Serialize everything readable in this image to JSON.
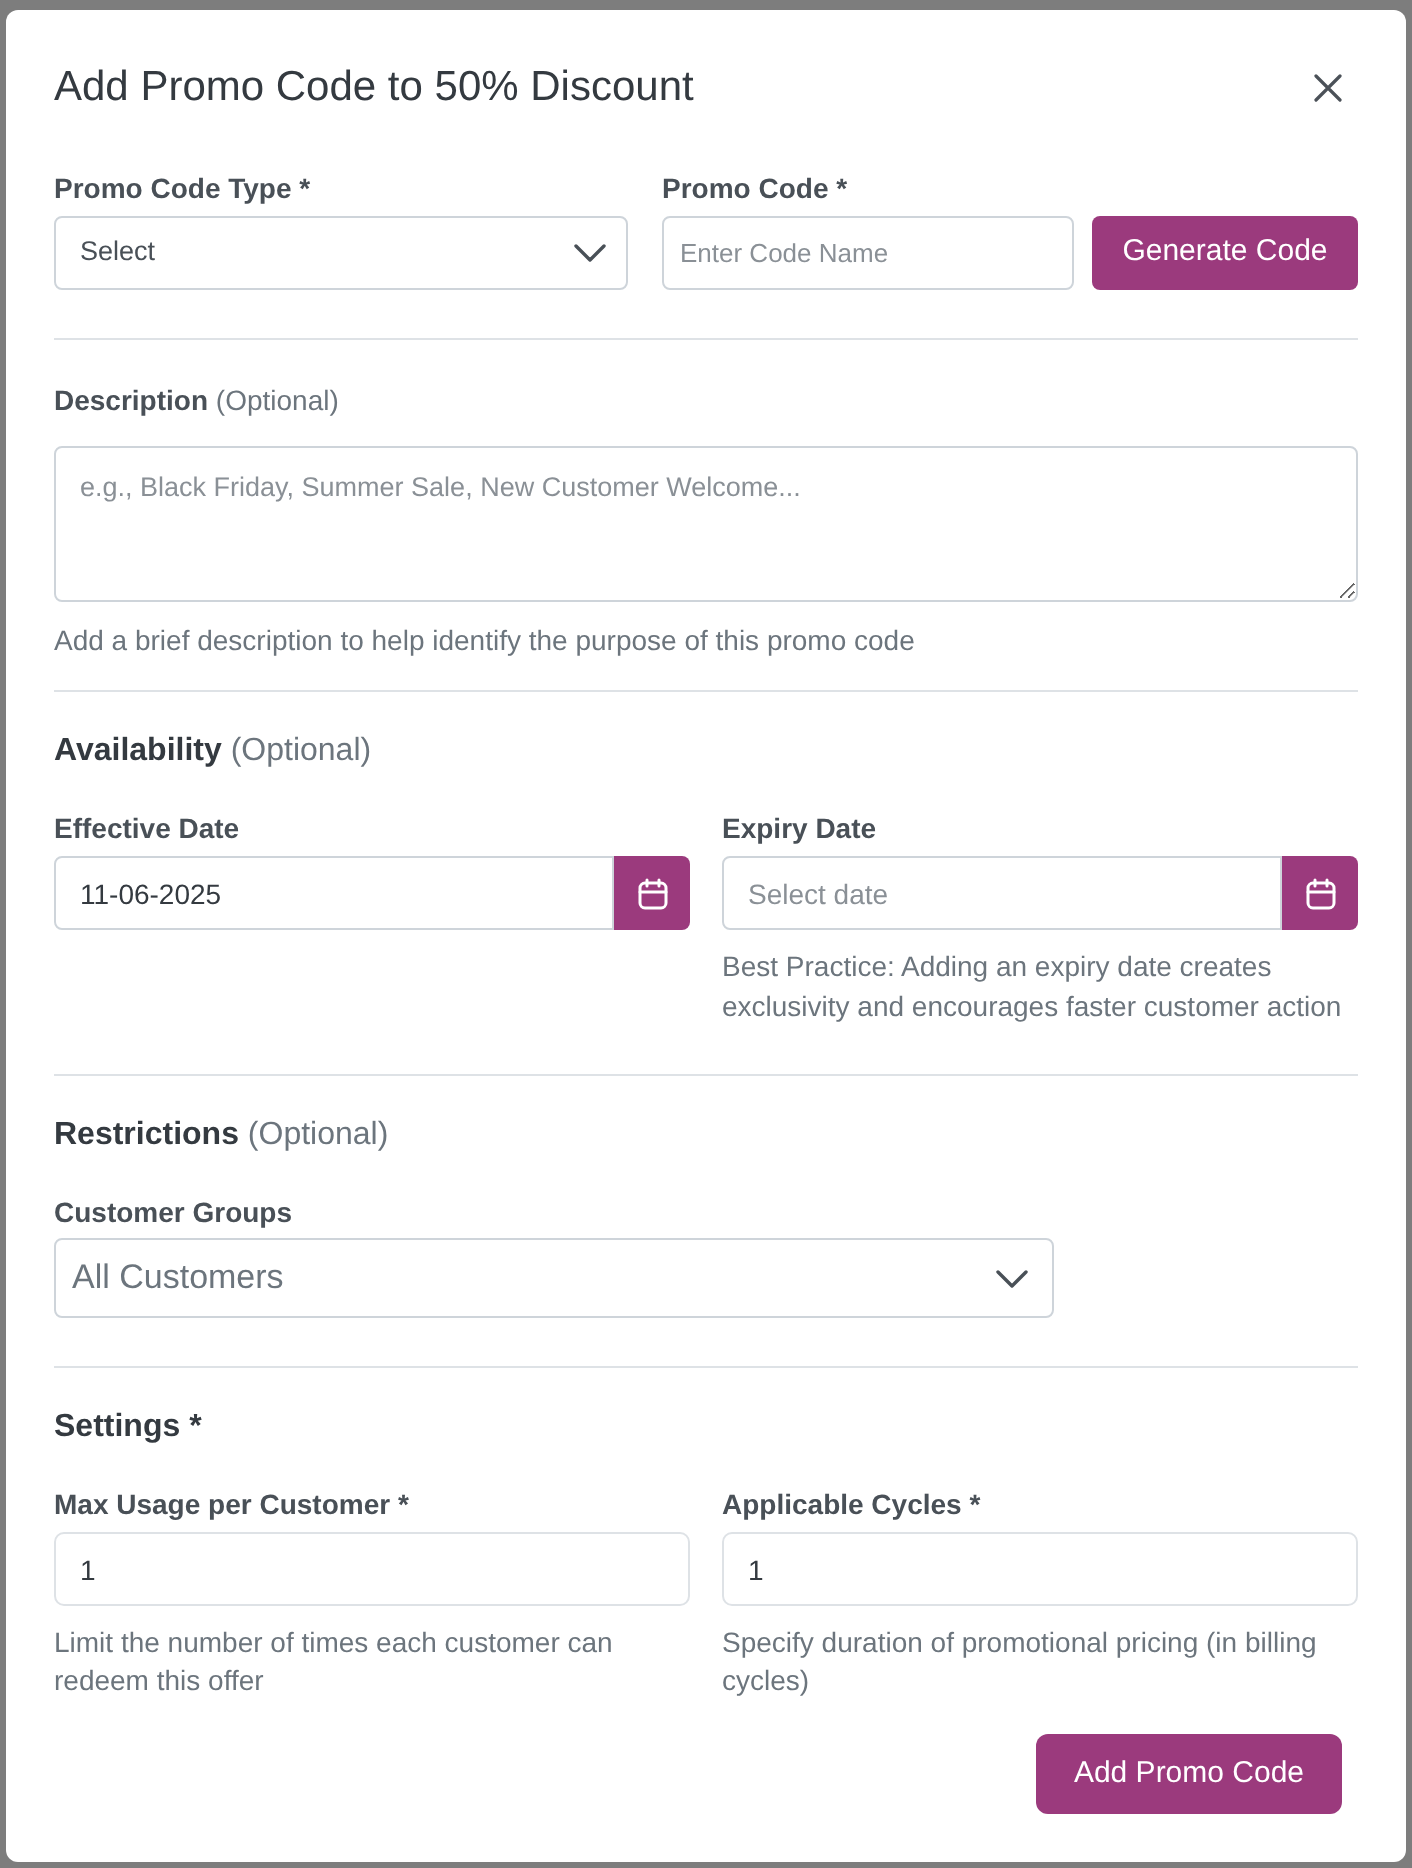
{
  "dialog": {
    "title": "Add Promo Code to 50% Discount"
  },
  "promo_code_type": {
    "label": "Promo Code Type *",
    "value": "Select"
  },
  "promo_code": {
    "label": "Promo Code *",
    "placeholder": "Enter Code Name",
    "button": "Generate Code"
  },
  "description": {
    "label": "**Description** (Optional)",
    "placeholder": "e.g., Black Friday, Summer Sale, New Customer Welcome...",
    "hint": "Add a brief description to help identify the purpose of this promo code"
  },
  "availability": {
    "heading": "**Availability** (Optional)",
    "effective_date": {
      "label": "Effective Date",
      "value": "11-06-2025"
    },
    "expiry_date": {
      "label": "Expiry Date",
      "placeholder": "Select date",
      "hint": "Best Practice: Adding an expiry date creates exclusivity and encourages faster customer action"
    }
  },
  "restrictions": {
    "heading": "**Restrictions** (Optional)",
    "customer_groups": {
      "label": "Customer Groups",
      "value": "All Customers"
    }
  },
  "settings": {
    "heading": "Settings *",
    "max_usage": {
      "label": "Max Usage per Customer *",
      "value": "1",
      "hint": "Limit the number of times each customer can redeem this offer"
    },
    "applicable_cycles": {
      "label": "Applicable Cycles *",
      "value": "1",
      "hint": "Specify duration of promotional pricing (in billing cycles)"
    }
  },
  "submit_button": "Add Promo Code"
}
